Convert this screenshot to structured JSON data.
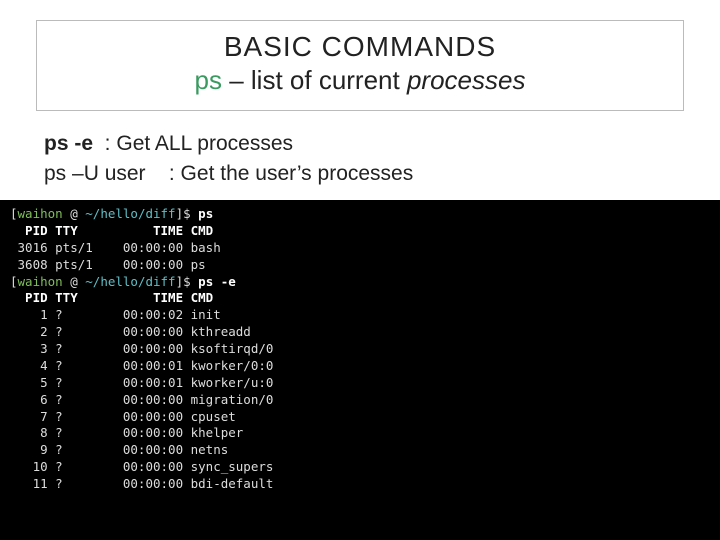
{
  "title": {
    "line1": "BASIC COMMANDS",
    "cmd": "ps",
    "dash": " – ",
    "desc_plain": "list of current ",
    "desc_em": "processes"
  },
  "desc": {
    "row1_cmd": "ps -e",
    "row1_rest": "  : Get ALL processes",
    "row2_cmd": "ps –U user",
    "row2_rest": "    : Get the user’s processes"
  },
  "terminal": {
    "user": "waihon",
    "at": " @ ",
    "path": "~/hello/diff",
    "prompt_open": "[",
    "prompt_close": "]$",
    "cmd1": "ps",
    "cmd2": "ps -e",
    "header": "  PID TTY          TIME CMD",
    "out1": [
      " 3016 pts/1    00:00:00 bash",
      " 3608 pts/1    00:00:00 ps"
    ],
    "out2": [
      "    1 ?        00:00:02 init",
      "    2 ?        00:00:00 kthreadd",
      "    3 ?        00:00:00 ksoftirqd/0",
      "    4 ?        00:00:01 kworker/0:0",
      "    5 ?        00:00:01 kworker/u:0",
      "    6 ?        00:00:00 migration/0",
      "    7 ?        00:00:00 cpuset",
      "    8 ?        00:00:00 khelper",
      "    9 ?        00:00:00 netns",
      "   10 ?        00:00:00 sync_supers",
      "   11 ?        00:00:00 bdi-default"
    ]
  }
}
